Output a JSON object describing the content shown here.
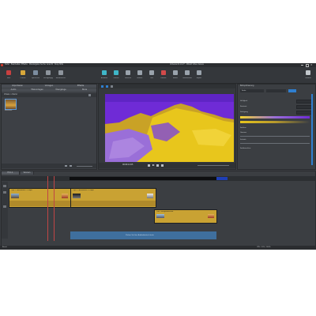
{
  "window": {
    "title": "Unbenannt.mxd* - MAGIX Video deluxe",
    "menu": [
      "Datei",
      "Bearbeiten",
      "Effekte",
      "Wiedergabe",
      "Suche",
      "Ansicht",
      "Shop",
      "Hilfe"
    ]
  },
  "toolbar": {
    "left_buttons": [
      "Neu",
      "Öffnen",
      "Speichern",
      "Rückgängig",
      "Wiederherst."
    ],
    "mid_buttons": [
      "Auswahl",
      "Schnitt",
      "Löschen",
      "Marker",
      "Titel",
      "Effekte",
      "Audio",
      "Überblende",
      "Export"
    ],
    "right_button": "Vollbild"
  },
  "media_pool": {
    "tabs_row1": [
      "Importieren",
      "Vorlagen",
      "Effekte"
    ],
    "tabs_row2": [
      "Audio",
      "Titelvorlagen",
      "Übergänge",
      "Store"
    ],
    "path": "Videos > Demo",
    "thumb_label": "Mountain"
  },
  "preview": {
    "timecode": "00:00:12:05"
  },
  "effects_panel": {
    "title": "Bildoptimierung",
    "dropdown": "Farbe",
    "labels": [
      "Helligkeit",
      "Kontrast",
      "Sättigung",
      "Farbton",
      "Gamma",
      "Schärfe"
    ],
    "section": "Farbkorrektur"
  },
  "timeline": {
    "tabs": [
      "Film 1",
      "Szenen"
    ],
    "clips": [
      {
        "label": "Clip 1 - Aufnahme (1).mp4"
      },
      {
        "label": "Clip 2 - Aufnahme (2).mp4"
      },
      {
        "label": "Titel - Berglandschaft"
      }
    ],
    "drop_hint": "Ziehen Sie hier Audiodateien hinein"
  },
  "statusbar": {
    "left": "Bereit",
    "right": "CPU: 12%  |  100%"
  },
  "colors": {
    "accent": "#2f7fd0",
    "clip_yellow": "#c9a233",
    "purple": "#6f2bd6",
    "yellow": "#e8c61c"
  }
}
